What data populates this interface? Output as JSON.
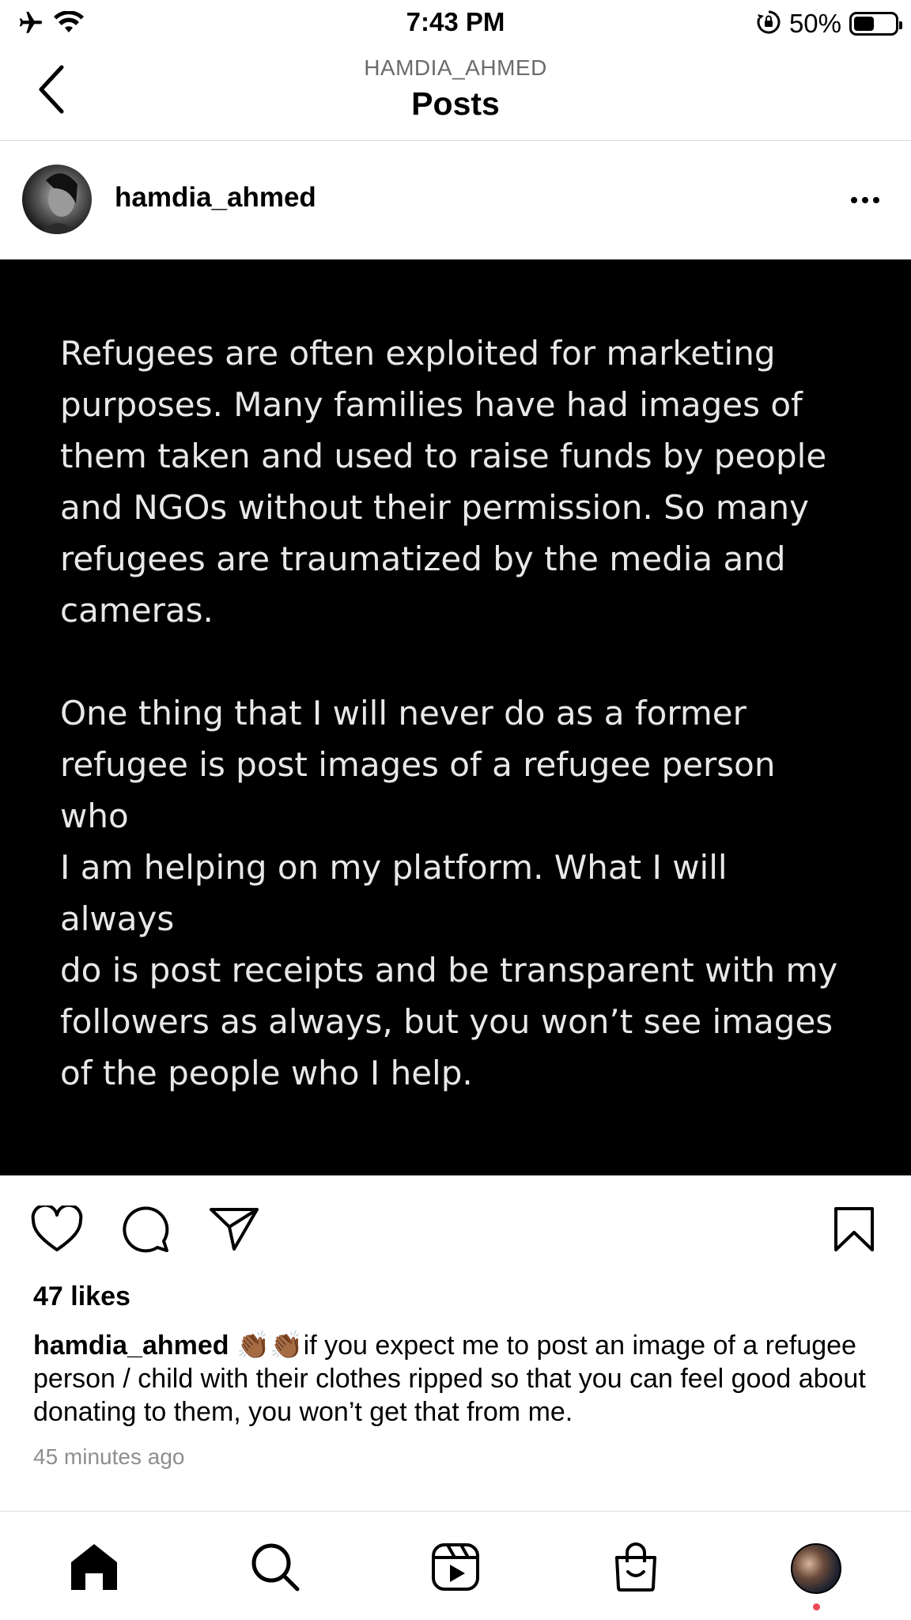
{
  "status_bar": {
    "time": "7:43 PM",
    "battery": "50%",
    "battery_level": 0.5,
    "icons": [
      "airplane-icon",
      "wifi-icon",
      "orientation-lock-icon",
      "battery-icon"
    ]
  },
  "header": {
    "subtitle": "HAMDIA_AHMED",
    "title": "Posts",
    "back_icon": "chevron-left-icon"
  },
  "post": {
    "username": "hamdia_ahmed",
    "image_text": [
      "Refugees are often exploited for marketing\npurposes. Many families have had images of\nthem taken and used to raise funds by people\nand NGOs without their permission. So many\nrefugees are traumatized by the media and\ncameras.",
      "One thing that I will never do as a former\nrefugee is post images of a refugee person who\nI am helping on my platform. What I will always\ndo is post receipts and be transparent with my\nfollowers as always, but you won’t see images\nof the people who I help."
    ],
    "likes": "47 likes",
    "caption_user": "hamdia_ahmed",
    "caption_emoji": "👏🏾👏🏾",
    "caption_text": "if you expect me to post an image of a refugee person / child with their clothes ripped so that you can feel good about donating to them, you won’t get that from me.",
    "timestamp": "45 minutes ago",
    "actions": [
      "heart-icon",
      "comment-icon",
      "share-icon",
      "bookmark-icon"
    ]
  },
  "tab_bar": {
    "tabs": [
      "home-icon",
      "search-icon",
      "reels-icon",
      "shop-icon",
      "profile-avatar"
    ],
    "notification_color": "#ed4956"
  }
}
